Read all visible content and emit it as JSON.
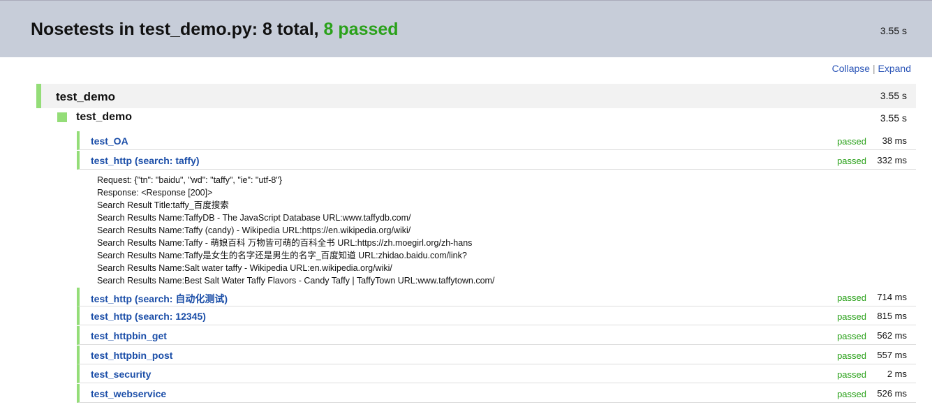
{
  "header": {
    "title_prefix": "Nosetests in test_demo.py: 8 total, ",
    "title_passed": "8 passed",
    "time": "3.55 s"
  },
  "controls": {
    "collapse": "Collapse",
    "sep": " | ",
    "expand": "Expand"
  },
  "suite": {
    "name": "test_demo",
    "time": "3.55 s"
  },
  "module": {
    "name": "test_demo",
    "time": "3.55 s"
  },
  "tests": [
    {
      "name": "test_OA",
      "status": "passed",
      "time": "38 ms"
    },
    {
      "name": "test_http (search: taffy)",
      "status": "passed",
      "time": "332 ms"
    },
    {
      "name": "test_http (search: 自动化测试)",
      "status": "passed",
      "time": "714 ms"
    },
    {
      "name": "test_http (search: 12345)",
      "status": "passed",
      "time": "815 ms"
    },
    {
      "name": "test_httpbin_get",
      "status": "passed",
      "time": "562 ms"
    },
    {
      "name": "test_httpbin_post",
      "status": "passed",
      "time": "557 ms"
    },
    {
      "name": "test_security",
      "status": "passed",
      "time": "2 ms"
    },
    {
      "name": "test_webservice",
      "status": "passed",
      "time": "526 ms"
    }
  ],
  "output": [
    "Request: {\"tn\": \"baidu\", \"wd\": \"taffy\", \"ie\": \"utf-8\"}",
    "Response: <Response [200]>",
    "Search Result Title:taffy_百度搜索",
    "Search Results Name:TaffyDB - The JavaScript Database URL:www.taffydb.com/",
    "Search Results Name:Taffy (candy) - Wikipedia URL:https://en.wikipedia.org/wiki/",
    "Search Results Name:Taffy - 萌娘百科 万物皆可萌的百科全书 URL:https://zh.moegirl.org/zh-hans",
    "Search Results Name:Taffy是女生的名字还是男生的名字_百度知道 URL:zhidao.baidu.com/link?",
    "Search Results Name:Salt water taffy - Wikipedia URL:en.wikipedia.org/wiki/",
    "Search Results Name:Best Salt Water Taffy Flavors - Candy Taffy | TaffyTown URL:www.taffytown.com/"
  ]
}
